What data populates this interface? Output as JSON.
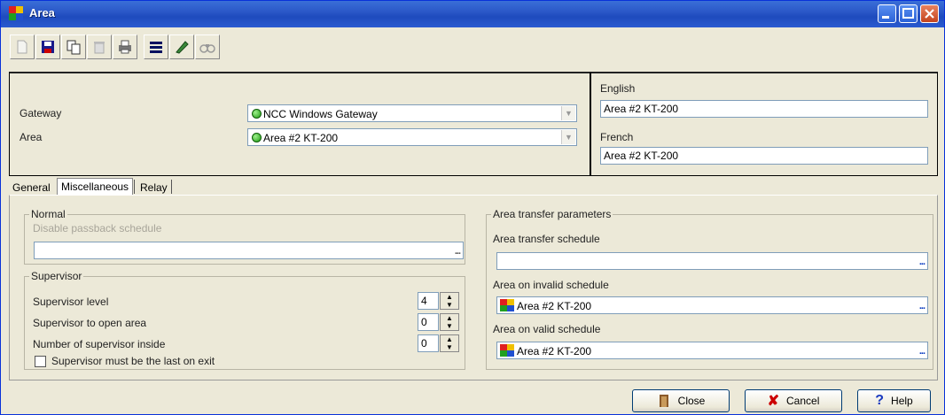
{
  "window": {
    "title": "Area"
  },
  "toolbar": {
    "buttons": [
      "new-icon",
      "save-icon",
      "copy-icon",
      "delete-icon",
      "print-icon",
      "list-icon",
      "edit-icon",
      "find-icon"
    ]
  },
  "header": {
    "gateway_label": "Gateway",
    "gateway_value": "NCC Windows Gateway",
    "area_label": "Area",
    "area_value": "Area #2 KT-200",
    "english_label": "English",
    "english_value": "Area #2 KT-200",
    "french_label": "French",
    "french_value": "Area #2 KT-200"
  },
  "tabs": [
    {
      "label": "General"
    },
    {
      "label": "Miscellaneous"
    },
    {
      "label": "Relay"
    }
  ],
  "normal": {
    "title": "Normal",
    "passback_label": "Disable passback schedule",
    "passback_value": ""
  },
  "supervisor": {
    "title": "Supervisor",
    "level_label": "Supervisor level",
    "level_value": "4",
    "open_label": "Supervisor to open area",
    "open_value": "0",
    "inside_label": "Number of supervisor inside",
    "inside_value": "0",
    "last_exit_label": "Supervisor must be the last on exit"
  },
  "transfer": {
    "title": "Area transfer parameters",
    "schedule_label": "Area transfer schedule",
    "schedule_value": "",
    "invalid_label": "Area on invalid schedule",
    "invalid_value": "Area #2 KT-200",
    "valid_label": "Area on valid schedule",
    "valid_value": "Area #2 KT-200"
  },
  "buttons": {
    "close": "Close",
    "cancel": "Cancel",
    "help": "Help"
  },
  "ellipsis": "..."
}
